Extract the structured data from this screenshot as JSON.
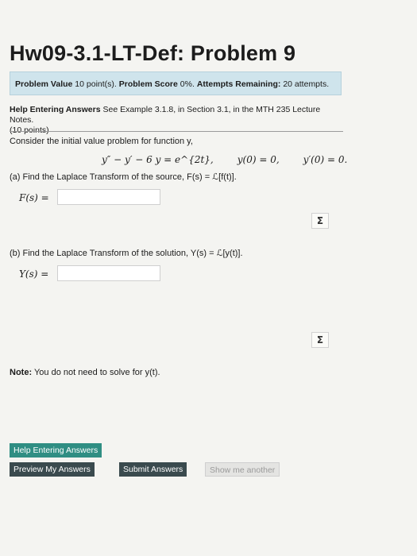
{
  "title": "Hw09-3.1-LT-Def: Problem 9",
  "info": {
    "problem_value_label": "Problem Value",
    "problem_value": "10 point(s).",
    "problem_score_label": "Problem Score",
    "problem_score": "0%.",
    "attempts_label": "Attempts Remaining:",
    "attempts_value": "20 attempts."
  },
  "help": {
    "bold_label": "Help Entering Answers",
    "text": "See Example 3.1.8, in Section 3.1, in the MTH 235 Lecture Notes.",
    "points": "(10 points)"
  },
  "problem": {
    "consider": "Consider the initial value problem for function y,",
    "eq_main": "y″ − y′ − 6 y = e^{2t},",
    "eq_ic1": "y(0) = 0,",
    "eq_ic2": "y′(0) = 0.",
    "part_a": "(a) Find the Laplace Transform of the source, F(s) = ℒ[f(t)].",
    "label_a": "F(s) =",
    "part_b": "(b) Find the Laplace Transform of the solution, Y(s) = ℒ[y(t)].",
    "label_b": "Y(s) =",
    "input_a_value": "",
    "input_b_value": "",
    "sigma": "Σ",
    "note_label": "Note:",
    "note_text": "You do not need to solve for y(t)."
  },
  "buttons": {
    "help_entering": "Help Entering Answers",
    "preview": "Preview My Answers",
    "submit": "Submit Answers",
    "show_another": "Show me another"
  }
}
